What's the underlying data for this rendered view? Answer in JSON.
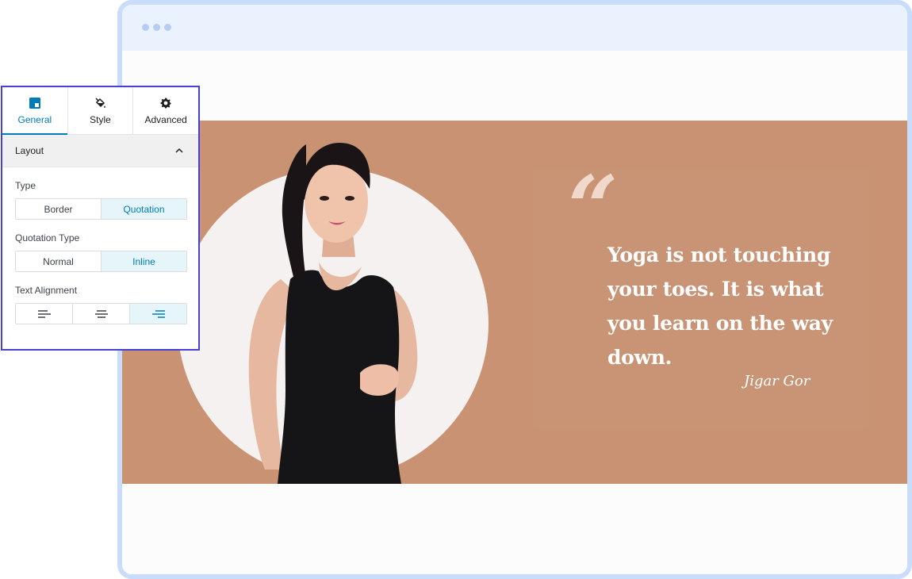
{
  "panel": {
    "tabs": [
      {
        "label": "General",
        "icon": "general-icon",
        "active": true
      },
      {
        "label": "Style",
        "icon": "paint-bucket-icon",
        "active": false
      },
      {
        "label": "Advanced",
        "icon": "gear-icon",
        "active": false
      }
    ],
    "section_title": "Layout",
    "type": {
      "label": "Type",
      "options": [
        "Border",
        "Quotation"
      ],
      "selected": "Quotation"
    },
    "quotation_type": {
      "label": "Quotation Type",
      "options": [
        "Normal",
        "Inline"
      ],
      "selected": "Inline"
    },
    "text_alignment": {
      "label": "Text Alignment",
      "options": [
        "align-left-icon",
        "align-center-icon",
        "align-right-icon"
      ],
      "selected": "align-right-icon"
    },
    "accent_color": "#007cba",
    "border_color": "#4540d6"
  },
  "preview": {
    "quote_mark": "“",
    "quote": "Yoga is not touching your toes. It is what you learn on the way down.",
    "author": "Jigar Gor",
    "background_color": "#c99373"
  }
}
